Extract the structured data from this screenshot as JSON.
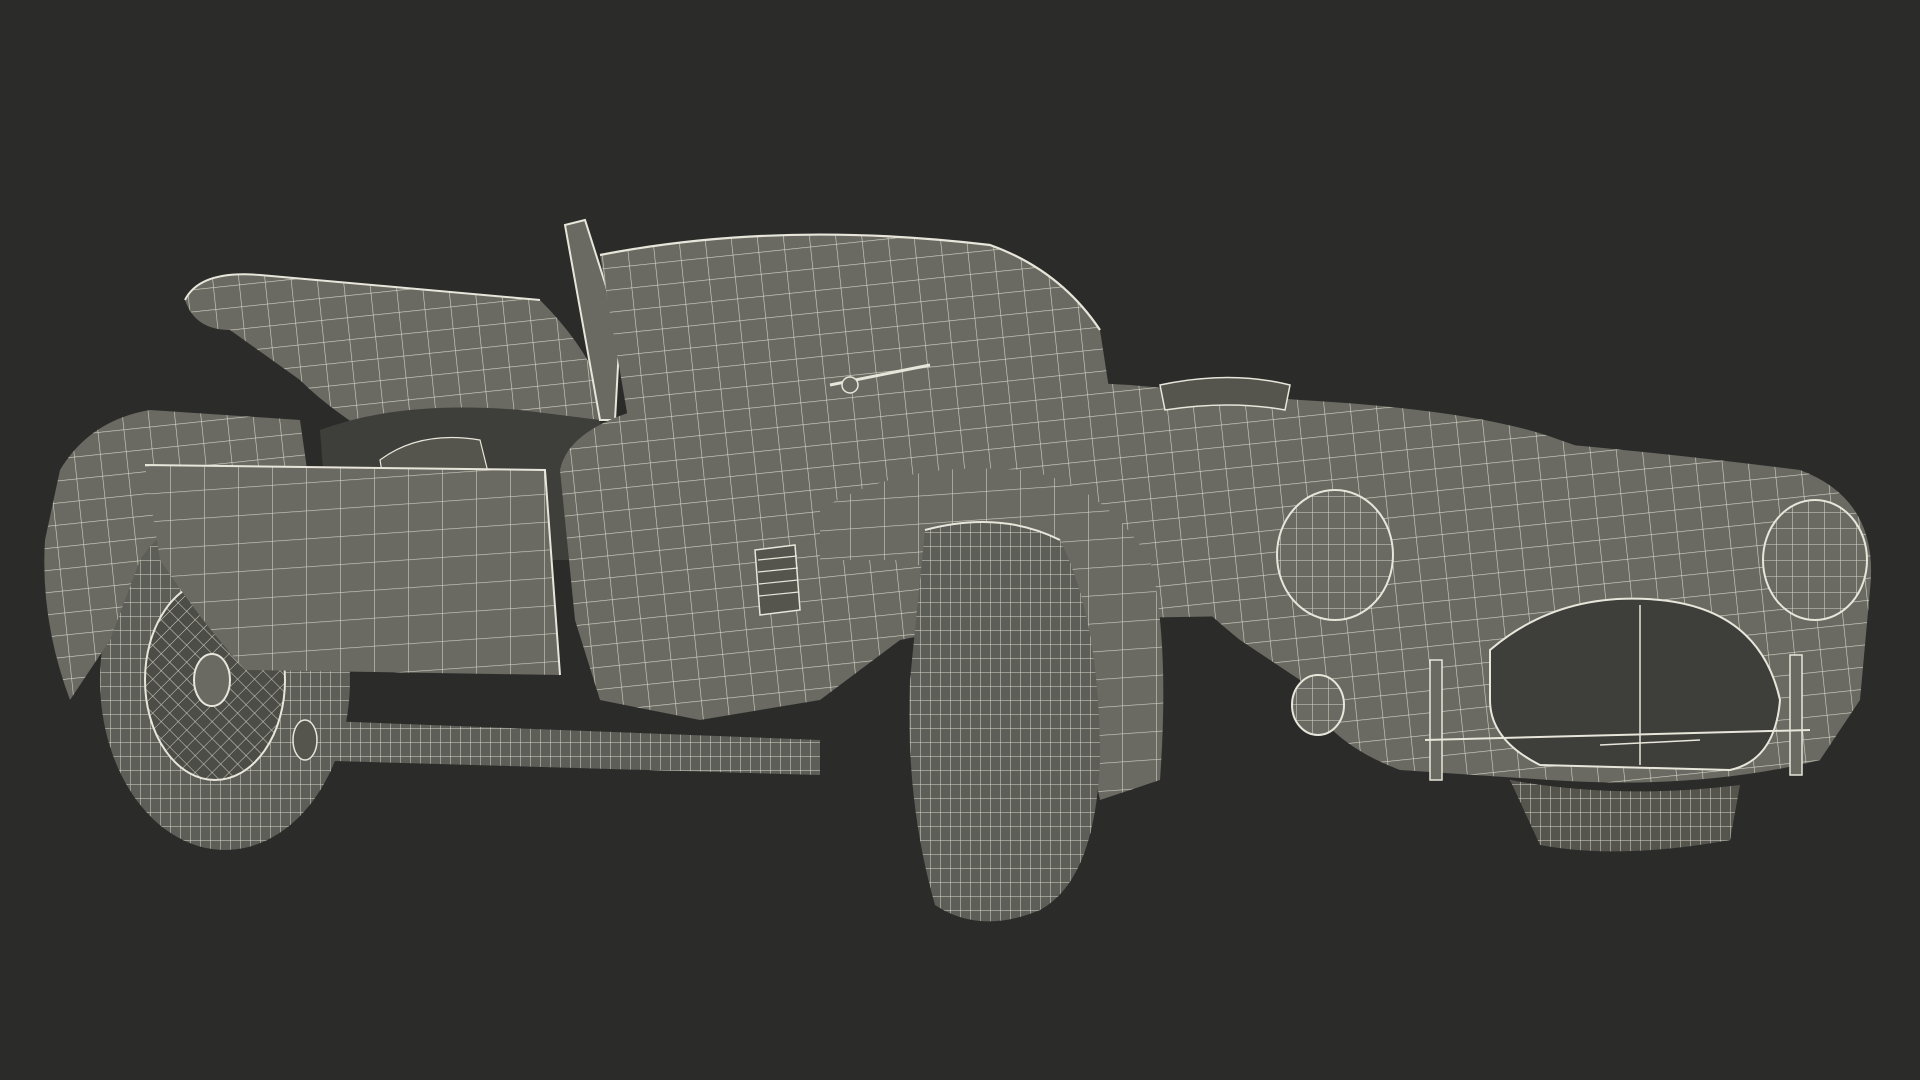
{
  "scene": {
    "subject": "wireframe-roadster",
    "background_color": "#2b2b2a",
    "body_color": "#6a6a62",
    "body_dark_color": "#55554e",
    "body_shadow_color": "#444440",
    "wire_color": "#e8e6da",
    "tire_color": "#5e5e58",
    "opening_color": "#3e3e3a"
  }
}
